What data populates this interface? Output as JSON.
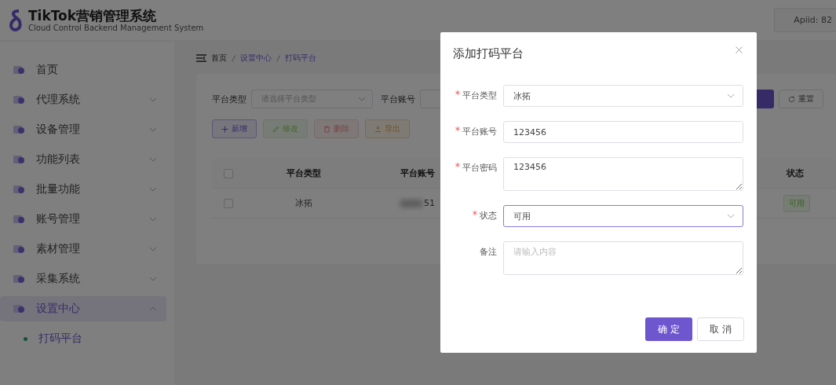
{
  "header": {
    "title": "TikTok营销管理系统",
    "subtitle": "Cloud Control Backend Management System",
    "api_id": "Apiid: 82"
  },
  "sidebar": {
    "items": [
      {
        "label": "首页",
        "expandable": false,
        "expanded": false,
        "selected": false
      },
      {
        "label": "代理系统",
        "expandable": true,
        "expanded": false,
        "selected": false
      },
      {
        "label": "设备管理",
        "expandable": true,
        "expanded": false,
        "selected": false
      },
      {
        "label": "功能列表",
        "expandable": true,
        "expanded": false,
        "selected": false
      },
      {
        "label": "批量功能",
        "expandable": true,
        "expanded": false,
        "selected": false
      },
      {
        "label": "账号管理",
        "expandable": true,
        "expanded": false,
        "selected": false
      },
      {
        "label": "素材管理",
        "expandable": true,
        "expanded": false,
        "selected": false
      },
      {
        "label": "采集系统",
        "expandable": true,
        "expanded": false,
        "selected": false
      },
      {
        "label": "设置中心",
        "expandable": true,
        "expanded": true,
        "selected": true,
        "children": [
          {
            "label": "打码平台",
            "selected": true
          }
        ]
      }
    ]
  },
  "breadcrumb": [
    "首页",
    "设置中心",
    "打码平台"
  ],
  "filters": [
    {
      "label": "平台类型",
      "kind": "select",
      "placeholder": "请选择平台类型"
    },
    {
      "label": "平台账号",
      "kind": "input"
    }
  ],
  "reset_button": {
    "label": "重置"
  },
  "actions": [
    {
      "label": "新增",
      "kind": "add",
      "disabled": false
    },
    {
      "label": "修改",
      "kind": "edit",
      "disabled": true
    },
    {
      "label": "删除",
      "kind": "delete",
      "disabled": true
    },
    {
      "label": "导出",
      "kind": "export",
      "disabled": false
    }
  ],
  "table": {
    "header_checked": false,
    "columns": [
      "平台类型",
      "平台账号",
      "状态"
    ],
    "rows": [
      {
        "checked": false,
        "cells": [
          "冰拓",
          "51",
          "可用"
        ]
      }
    ]
  },
  "dialog": {
    "title": "添加打码平台",
    "fields": [
      {
        "label": "平台类型",
        "required": true,
        "kind": "select",
        "value": "冰拓",
        "focused": false
      },
      {
        "label": "平台账号",
        "required": true,
        "kind": "input",
        "value": "123456"
      },
      {
        "label": "平台密码",
        "required": true,
        "kind": "textarea",
        "value": "123456"
      },
      {
        "label": "状态",
        "required": true,
        "kind": "select",
        "value": "可用",
        "focused": true
      },
      {
        "label": "备注",
        "required": false,
        "kind": "textarea",
        "placeholder": "请输入内容"
      }
    ],
    "buttons": [
      {
        "label": "确 定",
        "kind": "primary"
      },
      {
        "label": "取 消",
        "kind": "default"
      }
    ]
  }
}
